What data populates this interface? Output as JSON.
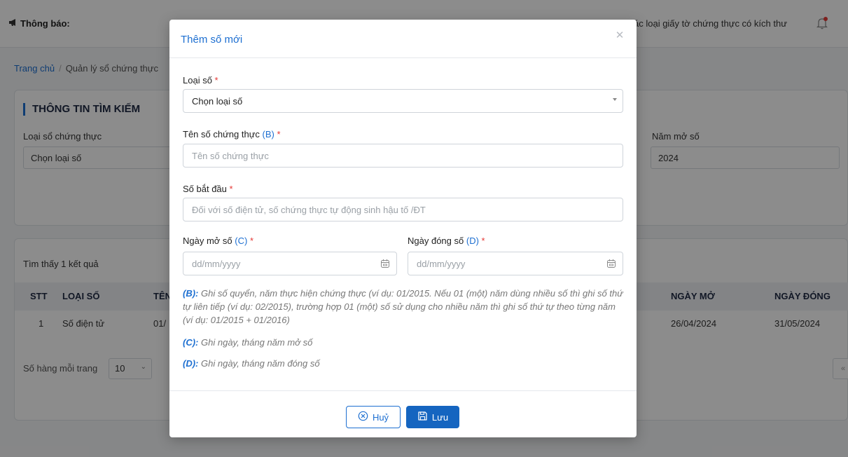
{
  "topbar": {
    "notice_label": "Thông báo:",
    "marquee_text": "ác loại giấy tờ chứng thực có kích thư",
    "icons": {
      "megaphone": "megaphone-icon",
      "bell": "bell-icon"
    },
    "bell_dot_color": "#e53935"
  },
  "breadcrumb": {
    "home": "Trang chủ",
    "separator": "/",
    "current": "Quản lý sổ chứng thực"
  },
  "search": {
    "title": "THÔNG TIN TÌM KIẾM",
    "type_label": "Loại sổ chứng thực",
    "type_value": "Chọn loại số",
    "year_label": "Năm mở số",
    "year_value": "2024"
  },
  "results": {
    "found_text": "Tìm thấy 1 kết quả",
    "columns": {
      "stt": "STT",
      "type": "LOẠI SỐ",
      "name_partial": "TÊN",
      "open_date": "NGÀY MỞ",
      "close_date": "NGÀY ĐÓNG"
    },
    "rows": [
      {
        "stt": "1",
        "type": "Số điện tử",
        "name_partial": "01/",
        "open_date": "26/04/2024",
        "close_date": "31/05/2024"
      }
    ],
    "pager": {
      "rows_label": "Số hàng mỗi trang",
      "rows_value": "10",
      "first_page": "«"
    }
  },
  "modal": {
    "title": "Thêm số mới",
    "close_icon": "close-icon",
    "fields": {
      "type": {
        "label": "Loại số",
        "required_mark": "*",
        "value": "Chọn loại số"
      },
      "name": {
        "label": "Tên số chứng thực",
        "ref": "(B)",
        "required_mark": "*",
        "placeholder": "Tên số chứng thực"
      },
      "start": {
        "label": "Số bắt đầu",
        "required_mark": "*",
        "placeholder": "Đối với số điện tử, số chứng thực tự động sinh hậu tố /ĐT"
      },
      "open_date": {
        "label": "Ngày mở số",
        "ref": "(C)",
        "required_mark": "*",
        "placeholder": "dd/mm/yyyy"
      },
      "close_date": {
        "label": "Ngày đóng số",
        "ref": "(D)",
        "required_mark": "*",
        "placeholder": "dd/mm/yyyy"
      }
    },
    "notes": {
      "b_key": "(B):",
      "b_text": "Ghi số quyển, năm thực hiện chứng thực (ví dụ: 01/2015. Nếu 01 (một) năm dùng nhiều số thì ghi số thứ tự liên tiếp (ví dụ: 02/2015), trường hợp 01 (một) số sử dụng cho nhiều năm thì ghi số thứ tự theo từng năm (ví dụ: 01/2015 + 01/2016)",
      "c_key": "(C):",
      "c_text": "Ghi ngày, tháng năm mở số",
      "d_key": "(D):",
      "d_text": "Ghi ngày, tháng năm đóng số"
    },
    "buttons": {
      "cancel": "Huỷ",
      "save": "Lưu"
    }
  },
  "colors": {
    "primary": "#1d6fd1",
    "save_bg": "#1565c0",
    "required": "#e53935"
  }
}
